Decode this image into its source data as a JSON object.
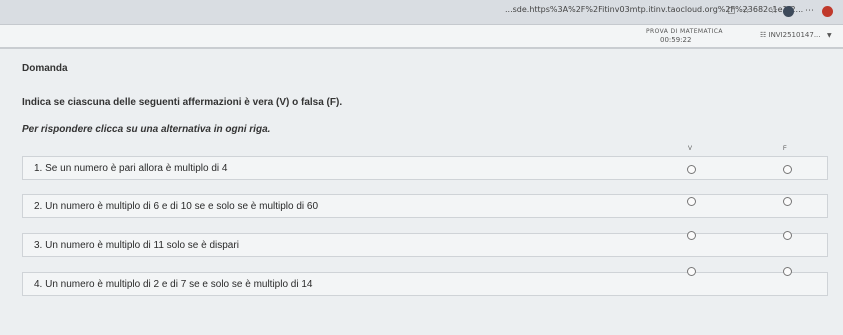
{
  "browser": {
    "url": "...sde.https%3A%2F%2Fitinv03mtp.itinv.taocloud.org%2F%23682c1e1f2..."
  },
  "header": {
    "test_title": "PROVA DI MATEMATICA",
    "timer": "00:59:22",
    "user": "☷ INVI2510147..."
  },
  "main": {
    "section_title": "Domanda",
    "instruction": "Indica se ciascuna delle seguenti affermazioni è vera (V) o falsa (F).",
    "sub_instruction": "Per rispondere clicca su una alternativa in ogni riga.",
    "col_true": "V",
    "col_false": "F",
    "statements": [
      {
        "label": "1. Se un numero è pari allora è multiplo di 4"
      },
      {
        "label": "2. Un numero è multiplo di 6 e di 10 se e solo se è multiplo di 60"
      },
      {
        "label": "3. Un numero è multiplo di 11 solo se è dispari"
      },
      {
        "label": "4. Un numero è multiplo di 2 e di 7 se e solo se è multiplo di 14"
      }
    ]
  }
}
